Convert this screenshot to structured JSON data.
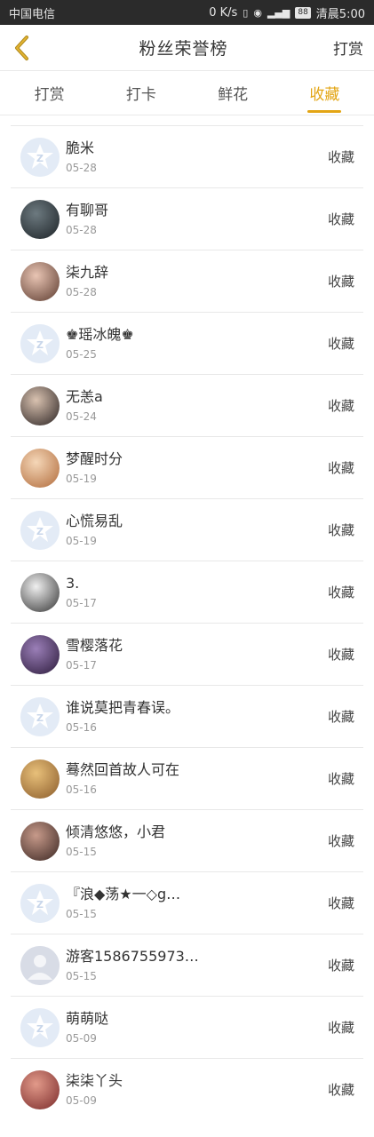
{
  "status_bar": {
    "carrier": "中国电信",
    "net_speed": "0 K/s",
    "battery": "88",
    "time_label": "清晨5:00"
  },
  "nav": {
    "back_icon": "chevron-left-icon",
    "title": "粉丝荣誉榜",
    "action": "打赏"
  },
  "tabs": [
    {
      "label": "打赏",
      "active": false
    },
    {
      "label": "打卡",
      "active": false
    },
    {
      "label": "鲜花",
      "active": false
    },
    {
      "label": "收藏",
      "active": true
    }
  ],
  "colors": {
    "accent": "#e3a514"
  },
  "list": [
    {
      "name": "脆米",
      "date": "05-28",
      "action": "收藏",
      "avatar": "default"
    },
    {
      "name": "有聊哥",
      "date": "05-28",
      "action": "收藏",
      "avatar": "photo"
    },
    {
      "name": "柒九辞",
      "date": "05-28",
      "action": "收藏",
      "avatar": "photo"
    },
    {
      "name": "♚瑶冰魄♚",
      "date": "05-25",
      "action": "收藏",
      "avatar": "default"
    },
    {
      "name": "无恙a",
      "date": "05-24",
      "action": "收藏",
      "avatar": "photo"
    },
    {
      "name": "梦醒时分",
      "date": "05-19",
      "action": "收藏",
      "avatar": "photo"
    },
    {
      "name": "心慌易乱",
      "date": "05-19",
      "action": "收藏",
      "avatar": "default"
    },
    {
      "name": "3.",
      "date": "05-17",
      "action": "收藏",
      "avatar": "photo"
    },
    {
      "name": "雪樱落花",
      "date": "05-17",
      "action": "收藏",
      "avatar": "photo"
    },
    {
      "name": "谁说莫把青春误。",
      "date": "05-16",
      "action": "收藏",
      "avatar": "default"
    },
    {
      "name": "蓦然回首故人可在",
      "date": "05-16",
      "action": "收藏",
      "avatar": "photo"
    },
    {
      "name": "倾清悠悠，小君",
      "date": "05-15",
      "action": "收藏",
      "avatar": "photo"
    },
    {
      "name": "『浪◆荡★一◇g…",
      "date": "05-15",
      "action": "收藏",
      "avatar": "default"
    },
    {
      "name": "游客1586755973…",
      "date": "05-15",
      "action": "收藏",
      "avatar": "guest"
    },
    {
      "name": "萌萌哒",
      "date": "05-09",
      "action": "收藏",
      "avatar": "default"
    },
    {
      "name": "柒柒丫头",
      "date": "05-09",
      "action": "收藏",
      "avatar": "photo"
    }
  ]
}
